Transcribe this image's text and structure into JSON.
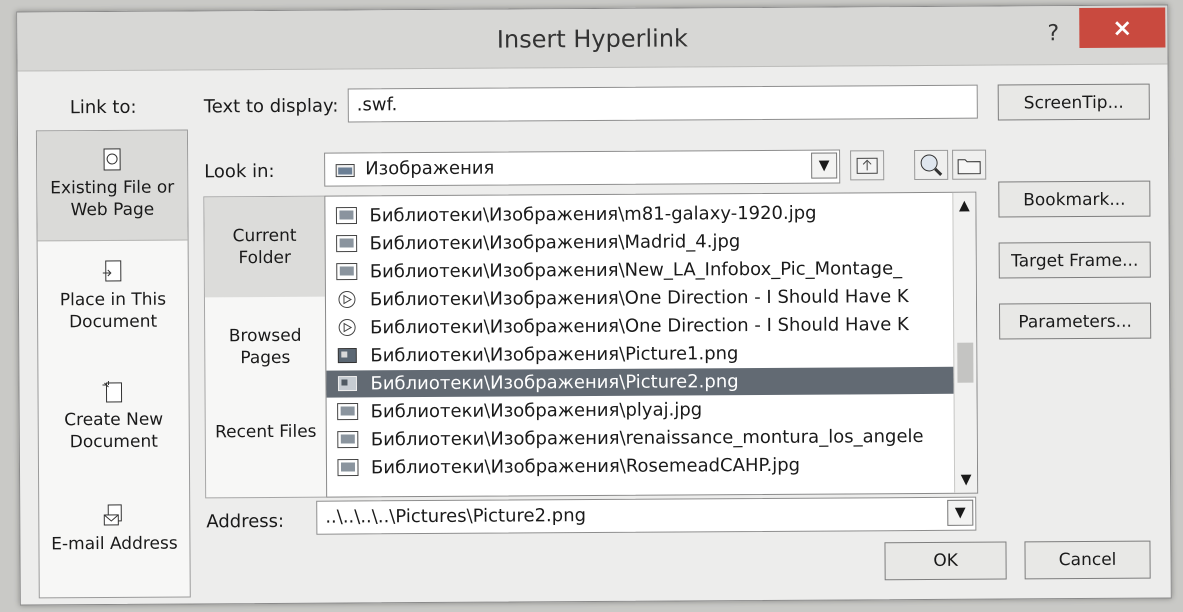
{
  "dialog": {
    "title": "Insert Hyperlink",
    "help": "?",
    "close": "×"
  },
  "link_to": {
    "label": "Link to:",
    "items": [
      {
        "label": "Existing File or Web Page",
        "icon": "existing-file-icon"
      },
      {
        "label": "Place in This Document",
        "icon": "place-document-icon"
      },
      {
        "label": "Create New Document",
        "icon": "new-document-icon"
      },
      {
        "label": "E-mail Address",
        "icon": "email-icon"
      }
    ]
  },
  "text_to_display": {
    "label": "Text to display:",
    "value": ".swf."
  },
  "look_in": {
    "label": "Look in:",
    "value": "Изображения"
  },
  "buttons": {
    "screentip": "ScreenTip...",
    "bookmark": "Bookmark...",
    "target_frame": "Target Frame...",
    "parameters": "Parameters...",
    "ok": "OK",
    "cancel": "Cancel"
  },
  "side_tabs": [
    "Current Folder",
    "Browsed Pages",
    "Recent Files"
  ],
  "files": [
    {
      "name": "Библиотеки\\Изображения\\m81-galaxy-1920.jpg",
      "type": "image"
    },
    {
      "name": "Библиотеки\\Изображения\\Madrid_4.jpg",
      "type": "image"
    },
    {
      "name": "Библиотеки\\Изображения\\New_LA_Infobox_Pic_Montage_",
      "type": "image"
    },
    {
      "name": "Библиотеки\\Изображения\\One Direction - I Should Have K",
      "type": "media"
    },
    {
      "name": "Библиотеки\\Изображения\\One Direction - I Should Have K",
      "type": "media"
    },
    {
      "name": "Библиотеки\\Изображения\\Picture1.png",
      "type": "png"
    },
    {
      "name": "Библиотеки\\Изображения\\Picture2.png",
      "type": "png",
      "selected": true
    },
    {
      "name": "Библиотеки\\Изображения\\plyaj.jpg",
      "type": "image"
    },
    {
      "name": "Библиотеки\\Изображения\\renaissance_montura_los_angele",
      "type": "image"
    },
    {
      "name": "Библиотеки\\Изображения\\RosemeadCAHP.jpg",
      "type": "image"
    }
  ],
  "address": {
    "label": "Address:",
    "value": "..\\..\\..\\..\\Pictures\\Picture2.png"
  },
  "colors": {
    "selection": "#626a73",
    "close_button": "#c94a3f",
    "dialog_bg": "#ededec"
  }
}
